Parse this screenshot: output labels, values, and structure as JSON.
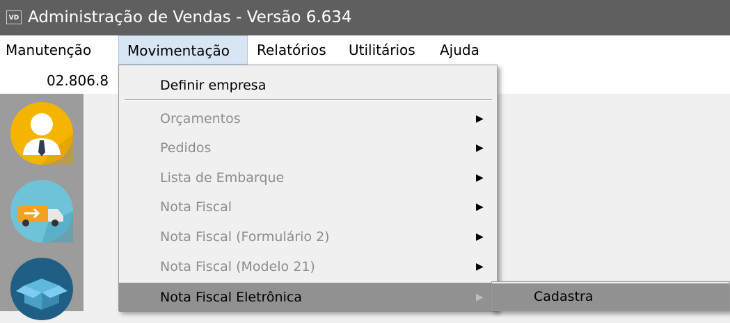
{
  "window": {
    "icon_text": "VD",
    "title": "Administração de Vendas - Versão 6.634"
  },
  "menubar": {
    "items": [
      {
        "label": "Manutenção"
      },
      {
        "label": "Movimentação"
      },
      {
        "label": "Relatórios"
      },
      {
        "label": "Utilitários"
      },
      {
        "label": "Ajuda"
      }
    ]
  },
  "infobar": {
    "value": "02.806.8"
  },
  "sidebar": {
    "icons": [
      {
        "name": "user-icon",
        "color": "#f4b400"
      },
      {
        "name": "delivery-truck-icon",
        "color": "#6fc3d9"
      },
      {
        "name": "box-icon",
        "color": "#1f5f85"
      }
    ]
  },
  "dropdown": {
    "items": [
      {
        "label": "Definir empresa"
      },
      {
        "label": "Orçamentos"
      },
      {
        "label": "Pedidos"
      },
      {
        "label": "Lista de Embarque"
      },
      {
        "label": "Nota Fiscal"
      },
      {
        "label": "Nota Fiscal (Formulário 2)"
      },
      {
        "label": "Nota Fiscal (Modelo 21)"
      },
      {
        "label": "Nota Fiscal Eletrônica"
      }
    ]
  },
  "submenu": {
    "items": [
      {
        "label": "Cadastra"
      }
    ]
  }
}
